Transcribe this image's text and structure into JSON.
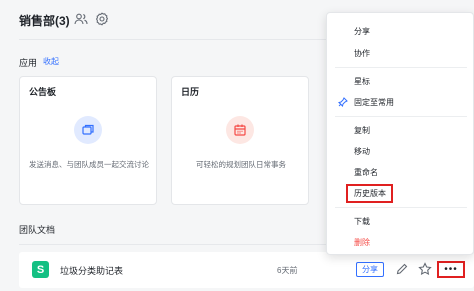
{
  "header": {
    "team_title": "销售部(3)",
    "icons": [
      "members-icon",
      "gear-icon"
    ]
  },
  "apps": {
    "section_label": "应用",
    "collapse_label": "收起",
    "cards": [
      {
        "title": "公告板",
        "desc": "发送消息、与团队成员一起交流讨论",
        "icon": "board-icon",
        "icon_bg": "#e1eaff",
        "icon_color": "#3370ff"
      },
      {
        "title": "日历",
        "desc": "可轻松的规划团队日常事务",
        "icon": "calendar-icon",
        "icon_bg": "#fde7e3",
        "icon_color": "#f54a45"
      }
    ]
  },
  "docs": {
    "section_label": "团队文档",
    "row": {
      "icon": "sheet-icon",
      "icon_glyph": "S",
      "name": "垃圾分类助记表",
      "time": "6天前",
      "share_label": "分享"
    }
  },
  "menu": {
    "items": [
      {
        "label": "分享"
      },
      {
        "label": "协作"
      },
      {
        "label": "星标"
      },
      {
        "label": "固定至常用",
        "icon": "pin-icon"
      },
      {
        "label": "复制"
      },
      {
        "label": "移动"
      },
      {
        "label": "重命名"
      },
      {
        "label": "历史版本",
        "highlighted": true
      },
      {
        "label": "下载"
      },
      {
        "label": "删除",
        "danger": true
      }
    ]
  },
  "colors": {
    "accent": "#3370ff",
    "danger": "#f54a45",
    "highlight_border": "#e02020",
    "sheet_green": "#14c083"
  }
}
